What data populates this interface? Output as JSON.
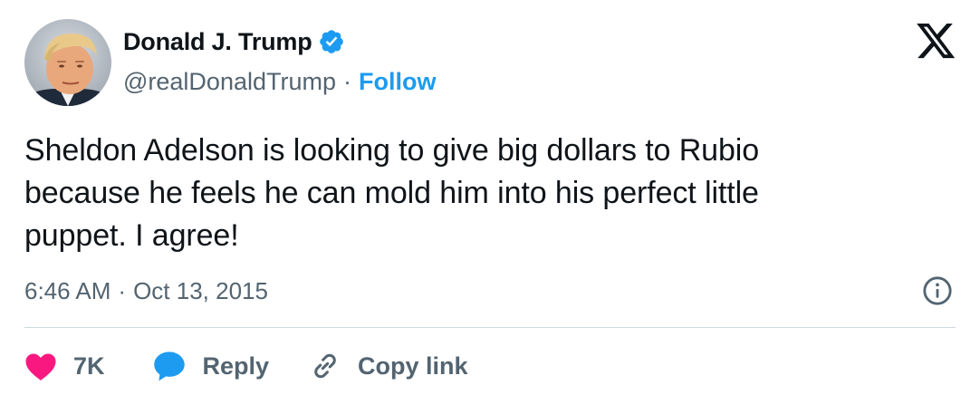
{
  "author": {
    "display_name": "Donald J. Trump",
    "handle": "@realDonaldTrump",
    "follow_label": "Follow",
    "verified": true,
    "separator": "·"
  },
  "tweet": {
    "text": "Sheldon Adelson is looking to give big dollars to Rubio\nbecause he feels he can mold him into his perfect little\npuppet. I agree!",
    "time": "6:46 AM",
    "date": "Oct 13, 2015",
    "separator": "·"
  },
  "actions": {
    "like_count": "7K",
    "reply_label": "Reply",
    "copy_link_label": "Copy link"
  },
  "icons": {
    "brand": "x-logo-icon",
    "verified": "verified-badge-icon",
    "info": "info-icon",
    "like": "heart-icon",
    "reply": "speech-bubble-icon",
    "copy": "link-icon"
  },
  "colors": {
    "text": "#0f1419",
    "secondary": "#536471",
    "accent": "#1d9bf0",
    "like": "#f91880",
    "divider": "#cfd9de"
  }
}
